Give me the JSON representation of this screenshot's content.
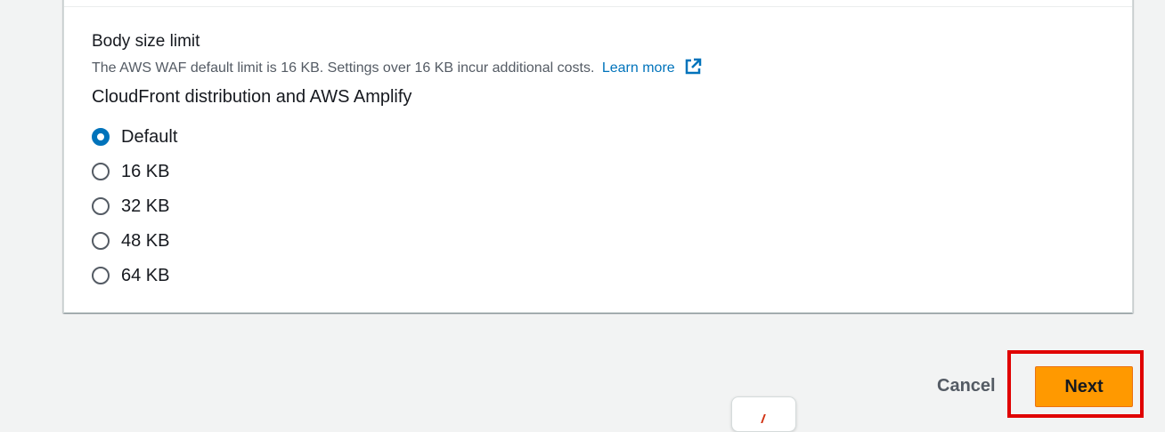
{
  "section": {
    "label": "Body size limit",
    "description": "The AWS WAF default limit is 16 KB. Settings over 16 KB incur additional costs.",
    "learn_more": "Learn more",
    "learn_more_icon": "external-link-icon",
    "group_label": "CloudFront distribution and AWS Amplify"
  },
  "radio_options": [
    {
      "label": "Default",
      "selected": true
    },
    {
      "label": "16 KB",
      "selected": false
    },
    {
      "label": "32 KB",
      "selected": false
    },
    {
      "label": "48 KB",
      "selected": false
    },
    {
      "label": "64 KB",
      "selected": false
    }
  ],
  "footer": {
    "cancel_label": "Cancel",
    "next_label": "Next"
  },
  "colors": {
    "primary_button": "#ff9900",
    "link": "#0073bb",
    "radio_selected": "#0073bb",
    "highlight": "#e00000",
    "page_background": "#f2f3f3"
  }
}
